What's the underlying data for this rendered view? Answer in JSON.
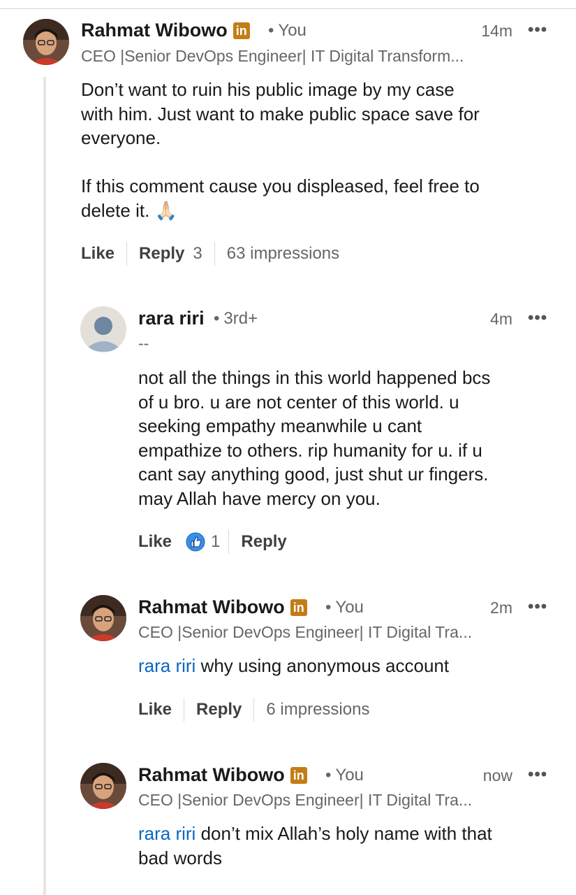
{
  "comments": [
    {
      "author": "Rahmat Wibowo",
      "badge": "in",
      "relation": "You",
      "time": "14m",
      "headline": "CEO |Senior DevOps Engineer| IT Digital Transform...",
      "lines": [
        "Don’t want to ruin his public image by my case",
        "with him. Just want to make public space save for",
        "everyone.",
        "",
        "If this comment cause you displeased, feel free to",
        "delete it. 🙏🏻"
      ],
      "actions": {
        "like": "Like",
        "reply": "Reply",
        "reply_count": "3",
        "impressions": "63 impressions"
      }
    },
    {
      "author": "rara riri",
      "relation": "3rd+",
      "time": "4m",
      "headline": "--",
      "lines": [
        "not all the things in this world happened bcs",
        "of u bro. u are not center of this world. u",
        "seeking empathy meanwhile u cant",
        "empathize to others. rip humanity for u. if u",
        "cant say anything good, just shut ur fingers.",
        "may Allah have mercy on you."
      ],
      "actions": {
        "like": "Like",
        "reaction_count": "1",
        "reply": "Reply"
      }
    },
    {
      "author": "Rahmat Wibowo",
      "badge": "in",
      "relation": "You",
      "time": "2m",
      "headline": "CEO |Senior DevOps Engineer| IT Digital Tra...",
      "mention": "rara riri",
      "lines": [
        " why using anonymous account"
      ],
      "actions": {
        "like": "Like",
        "reply": "Reply",
        "impressions": "6 impressions"
      }
    },
    {
      "author": "Rahmat Wibowo",
      "badge": "in",
      "relation": "You",
      "time": "now",
      "headline": "CEO |Senior DevOps Engineer| IT Digital Tra...",
      "mention": "rara riri",
      "lines": [
        " don’t mix Allah’s holy name with that",
        "bad words"
      ]
    }
  ],
  "ui": {
    "more_glyph": "•••",
    "separator_dot": "•"
  },
  "colors": {
    "mention": "#0a66c2",
    "linkedin_badge": "#c37d16",
    "thread_line": "#e8e5df"
  }
}
